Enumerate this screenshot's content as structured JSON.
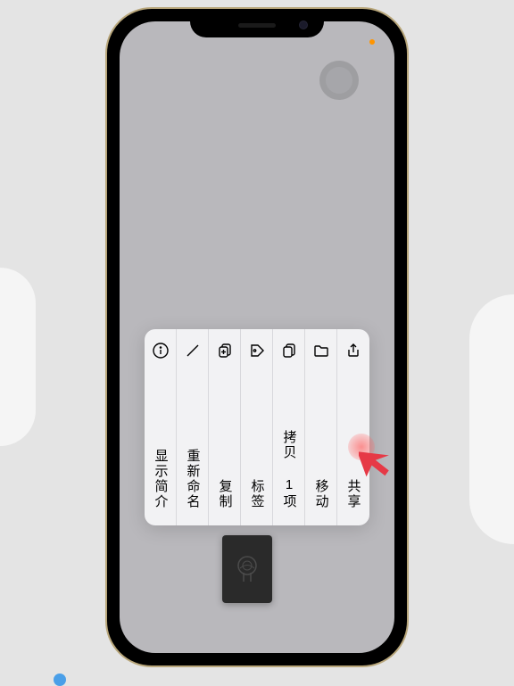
{
  "menu": {
    "items": [
      {
        "id": "info",
        "label": "显示简介",
        "icon": "info-circle-icon"
      },
      {
        "id": "rename",
        "label": "重新命名",
        "icon": "pencil-icon"
      },
      {
        "id": "copy",
        "label": "复制",
        "icon": "duplicate-icon"
      },
      {
        "id": "tags",
        "label": "标签",
        "icon": "tag-icon"
      },
      {
        "id": "copy-item",
        "label": "拷贝 1项",
        "icon": "copy-doc-icon"
      },
      {
        "id": "move",
        "label": "移动",
        "icon": "folder-icon"
      },
      {
        "id": "share",
        "label": "共享",
        "icon": "share-icon"
      }
    ]
  },
  "file": {
    "app": "garageband"
  }
}
